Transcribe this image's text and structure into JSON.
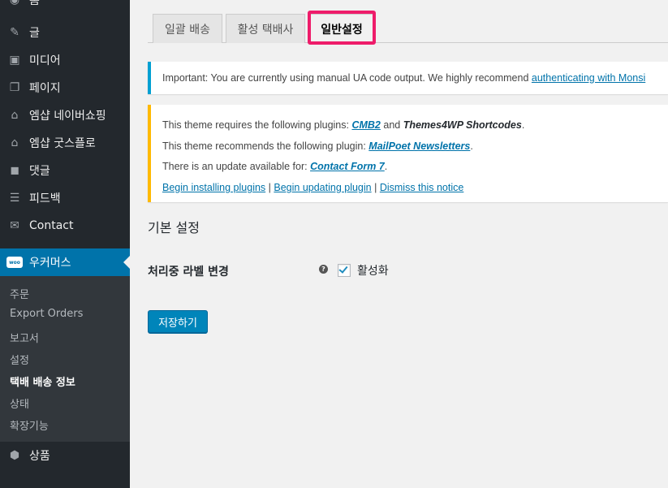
{
  "sidebar": {
    "menu": [
      {
        "label": "홈",
        "icon": "dashboard-icon",
        "glyph": "◉"
      },
      {
        "label": "글",
        "icon": "pin-icon",
        "glyph": "✎"
      },
      {
        "label": "미디어",
        "icon": "media-icon",
        "glyph": "▣"
      },
      {
        "label": "페이지",
        "icon": "page-icon",
        "glyph": "❐"
      },
      {
        "label": "엠샵 네이버쇼핑",
        "icon": "shop-icon",
        "glyph": "⌂"
      },
      {
        "label": "엠샵 굿스플로",
        "icon": "shop-icon",
        "glyph": "⌂"
      },
      {
        "label": "댓글",
        "icon": "comment-icon",
        "glyph": "◼"
      },
      {
        "label": "피드백",
        "icon": "feedback-icon",
        "glyph": "☰"
      },
      {
        "label": "Contact",
        "icon": "mail-icon",
        "glyph": "✉"
      }
    ],
    "active_menu": {
      "label": "우커머스",
      "icon": "woocommerce-icon",
      "badge": "woo"
    },
    "submenu": [
      {
        "label": "주문",
        "current": false
      },
      {
        "label": "Export Orders",
        "current": false
      },
      {
        "label": "보고서",
        "current": false
      },
      {
        "label": "설정",
        "current": false
      },
      {
        "label": "택배 배송 정보",
        "current": true
      },
      {
        "label": "상태",
        "current": false
      },
      {
        "label": "확장기능",
        "current": false
      }
    ],
    "bottom_menu": [
      {
        "label": "상품",
        "icon": "product-icon",
        "glyph": "⬢"
      }
    ]
  },
  "tabs": [
    {
      "label": "일괄 배송",
      "active": false
    },
    {
      "label": "활성 택배사",
      "active": false
    },
    {
      "label": "일반설정",
      "active": true
    }
  ],
  "notice_info": {
    "text": "Important: You are currently using manual UA code output. We highly recommend ",
    "link": "authenticating with Monsi"
  },
  "notice_warn": {
    "line1_prefix": "This theme requires the following plugins: ",
    "line1_link": "CMB2",
    "line1_mid": " and ",
    "line1_strong": "Themes4WP Shortcodes",
    "line1_suffix": ".",
    "line2_prefix": "This theme recommends the following plugin: ",
    "line2_link": "MailPoet Newsletters",
    "line2_suffix": ".",
    "line3_prefix": "There is an update available for: ",
    "line3_link": "Contact Form 7",
    "line3_suffix": ".",
    "action1": "Begin installing plugins",
    "action2": "Begin updating plugin",
    "action3": "Dismiss this notice",
    "separator": " | "
  },
  "settings": {
    "section_title": "기본 설정",
    "field_label": "처리중 라벨 변경",
    "help_glyph": "?",
    "checkbox_label": "활성화",
    "checked": true,
    "save_label": "저장하기"
  },
  "colors": {
    "sidebar_bg": "#23282d",
    "active_bg": "#0073aa",
    "highlight": "#ee1c6a",
    "info_border": "#00a0d2",
    "warn_border": "#ffb900",
    "button": "#0085ba"
  }
}
